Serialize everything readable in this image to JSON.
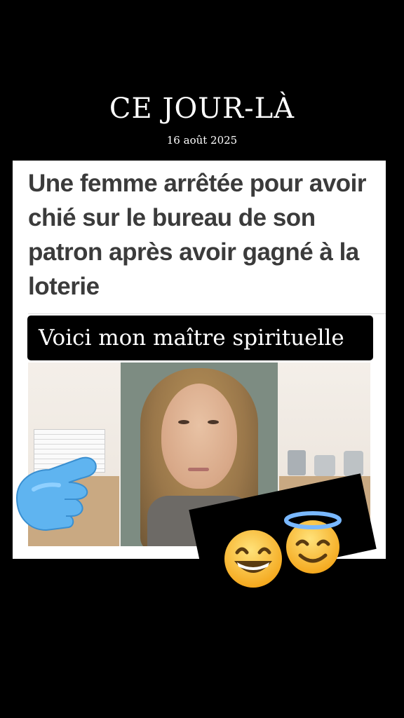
{
  "header": {
    "title": "CE JOUR-LÀ",
    "date": "16 août 2025"
  },
  "article": {
    "headline": "Une femme arrêtée pour avoir chié sur le bureau de son patron après avoir gagné à la loterie",
    "caption": "Voici mon maître spirituelle"
  },
  "stickers": {
    "pointing_hand": "backhand-index-pointing-right-icon",
    "emoji_1": "grinning-face-with-smiling-eyes-icon",
    "emoji_2": "smiling-face-with-halo-icon"
  },
  "colors": {
    "background": "#000000",
    "headline_text": "#3b3b3b",
    "caption_bg": "#000000",
    "caption_text": "#ffffff"
  }
}
